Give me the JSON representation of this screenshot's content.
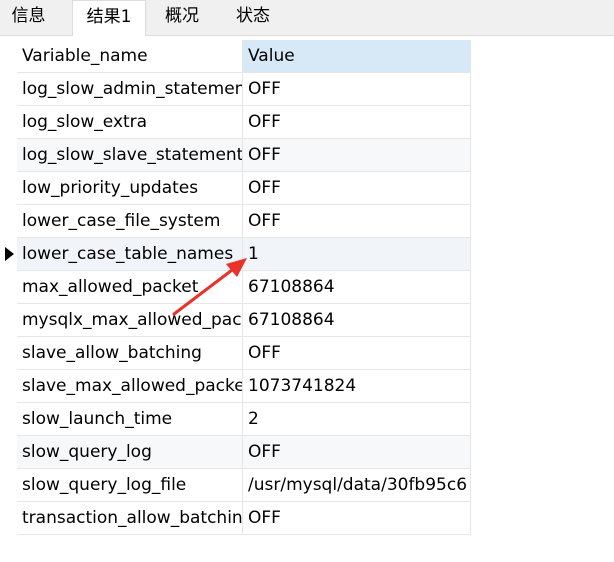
{
  "tabs": [
    {
      "label": "信息"
    },
    {
      "label": "结果1"
    },
    {
      "label": "概况"
    },
    {
      "label": "状态"
    }
  ],
  "table": {
    "columns": [
      "Variable_name",
      "Value"
    ],
    "rows": [
      {
        "name": "log_slow_admin_statements",
        "value": "OFF"
      },
      {
        "name": "log_slow_extra",
        "value": "OFF"
      },
      {
        "name": "log_slow_slave_statements",
        "value": "OFF"
      },
      {
        "name": "low_priority_updates",
        "value": "OFF"
      },
      {
        "name": "lower_case_file_system",
        "value": "OFF"
      },
      {
        "name": "lower_case_table_names",
        "value": "1"
      },
      {
        "name": "max_allowed_packet",
        "value": "67108864"
      },
      {
        "name": "mysqlx_max_allowed_packet",
        "value": "67108864"
      },
      {
        "name": "slave_allow_batching",
        "value": "OFF"
      },
      {
        "name": "slave_max_allowed_packet",
        "value": "1073741824"
      },
      {
        "name": "slow_launch_time",
        "value": "2"
      },
      {
        "name": "slow_query_log",
        "value": "OFF"
      },
      {
        "name": "slow_query_log_file",
        "value": "/usr/mysql/data/30fb95c6"
      },
      {
        "name": "transaction_allow_batching",
        "value": "OFF"
      }
    ]
  },
  "colors": {
    "annotation_arrow": "#e8322a",
    "header_value_bg": "#d7e8f6"
  }
}
